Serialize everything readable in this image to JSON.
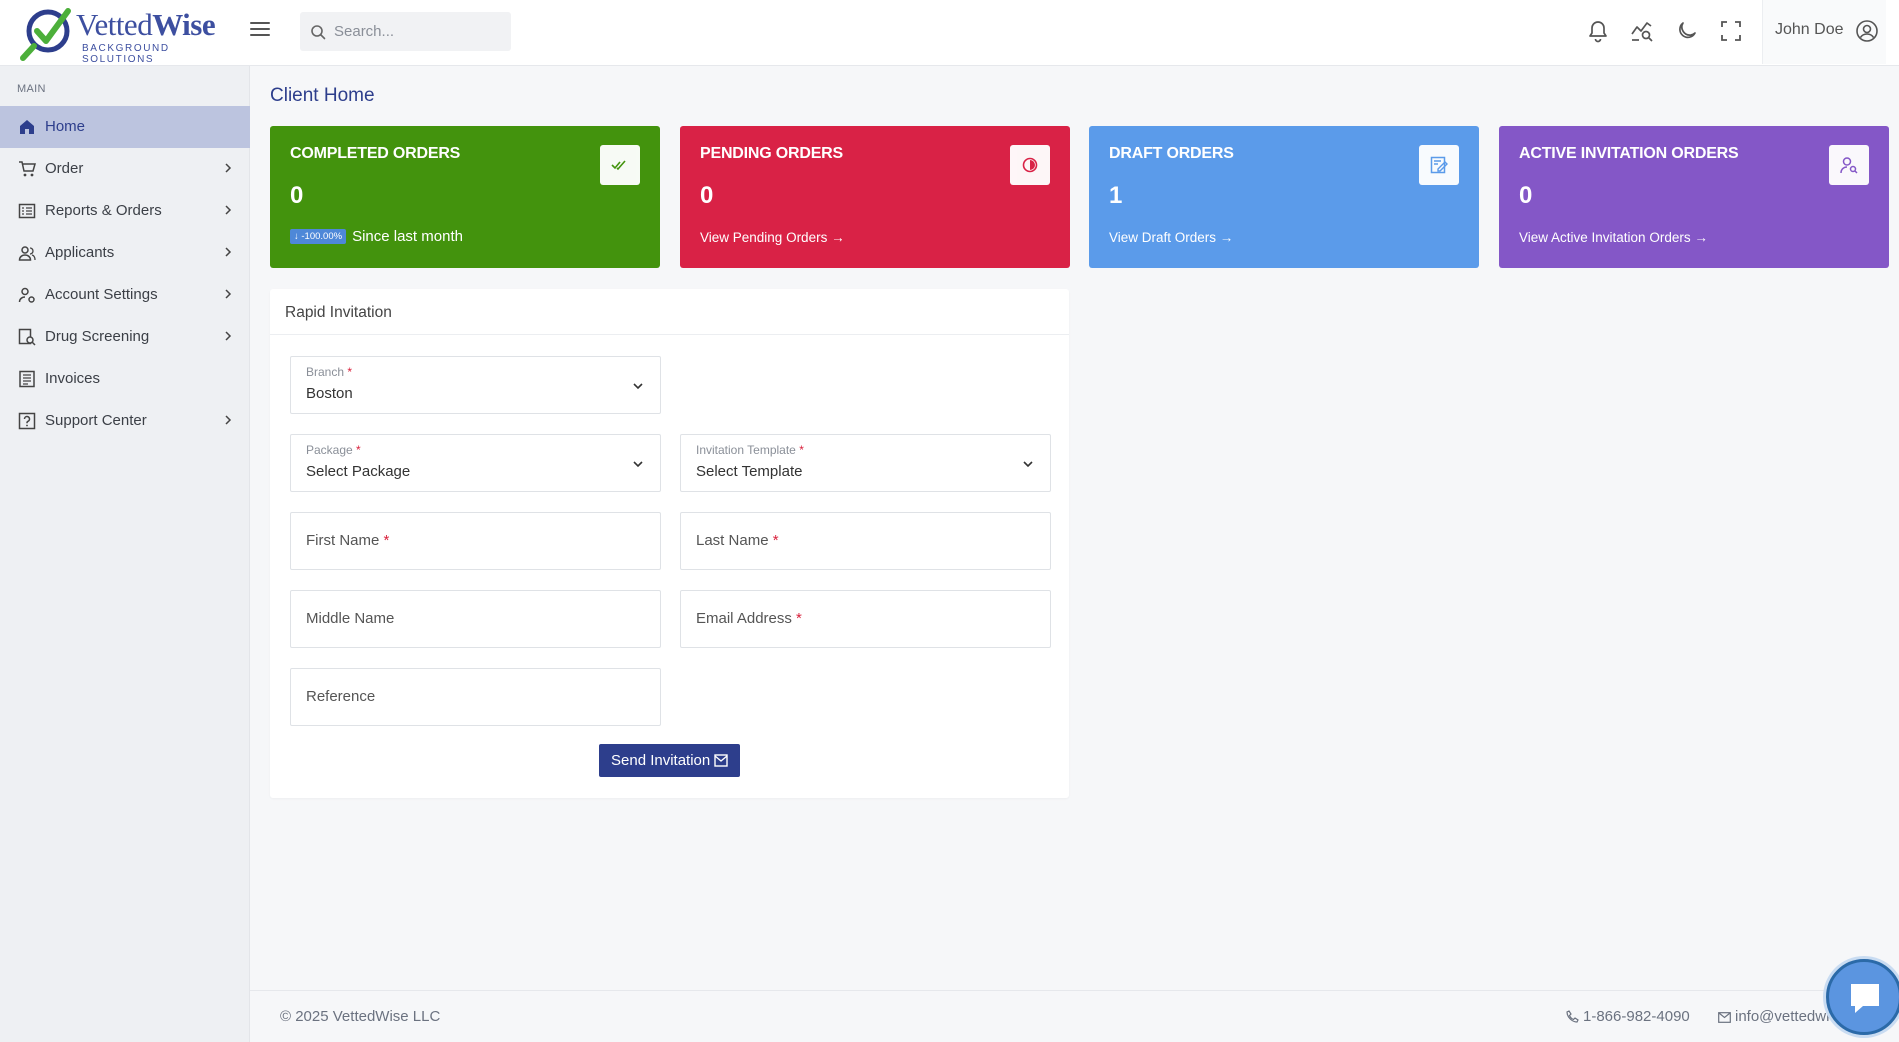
{
  "brand": {
    "name_part1": "Vetted",
    "name_part2": "Wise",
    "tagline": "BACKGROUND SOLUTIONS"
  },
  "header": {
    "search_placeholder": "Search...",
    "user_name": "John Doe",
    "icons": [
      "bell-icon",
      "analytics-search-icon",
      "moon-icon",
      "fullscreen-icon",
      "user-circle-icon"
    ]
  },
  "sidebar": {
    "section_label": "MAIN",
    "items": [
      {
        "label": "Home",
        "icon": "home-icon",
        "active": true,
        "has_submenu": false
      },
      {
        "label": "Order",
        "icon": "cart-icon",
        "active": false,
        "has_submenu": true
      },
      {
        "label": "Reports & Orders",
        "icon": "report-icon",
        "active": false,
        "has_submenu": true
      },
      {
        "label": "Applicants",
        "icon": "users-icon",
        "active": false,
        "has_submenu": true
      },
      {
        "label": "Account Settings",
        "icon": "user-settings-icon",
        "active": false,
        "has_submenu": true
      },
      {
        "label": "Drug Screening",
        "icon": "drug-search-icon",
        "active": false,
        "has_submenu": true
      },
      {
        "label": "Invoices",
        "icon": "invoice-icon",
        "active": false,
        "has_submenu": false
      },
      {
        "label": "Support Center",
        "icon": "help-icon",
        "active": false,
        "has_submenu": true
      }
    ]
  },
  "main": {
    "page_title": "Client Home",
    "cards": [
      {
        "title": "COMPLETED ORDERS",
        "value": "0",
        "badge": "↓ -100.00%",
        "link": "Since last month",
        "color": "#43930d",
        "icon": "double-check-icon"
      },
      {
        "title": "PENDING ORDERS",
        "value": "0",
        "link": "View Pending Orders →",
        "color": "#d92246",
        "icon": "timer-icon"
      },
      {
        "title": "DRAFT ORDERS",
        "value": "1",
        "link": "View Draft Orders →",
        "color": "#5b9bea",
        "icon": "edit-note-icon"
      },
      {
        "title": "ACTIVE INVITATION ORDERS",
        "value": "0",
        "link": "View Active Invitation Orders →",
        "color": "#8457c7",
        "icon": "user-search-icon"
      }
    ],
    "rapid_invitation": {
      "title": "Rapid Invitation",
      "branch": {
        "label": "Branch",
        "value": "Boston",
        "required": "*"
      },
      "package": {
        "label": "Package",
        "value": "Select Package",
        "required": "*"
      },
      "template": {
        "label": "Invitation Template",
        "value": "Select Template",
        "required": "*"
      },
      "first_name": {
        "label": "First Name",
        "required": "*"
      },
      "last_name": {
        "label": "Last Name",
        "required": "*"
      },
      "middle_name": {
        "label": "Middle Name"
      },
      "email": {
        "label": "Email Address",
        "required": "*"
      },
      "reference": {
        "label": "Reference"
      },
      "submit_label": "Send Invitation"
    }
  },
  "footer": {
    "copyright": "© 2025 VettedWise LLC",
    "phone": "1-866-982-4090",
    "email": "info@vettedwi"
  },
  "colors": {
    "primary": "#2d3e8c",
    "required": "#d9213c"
  }
}
